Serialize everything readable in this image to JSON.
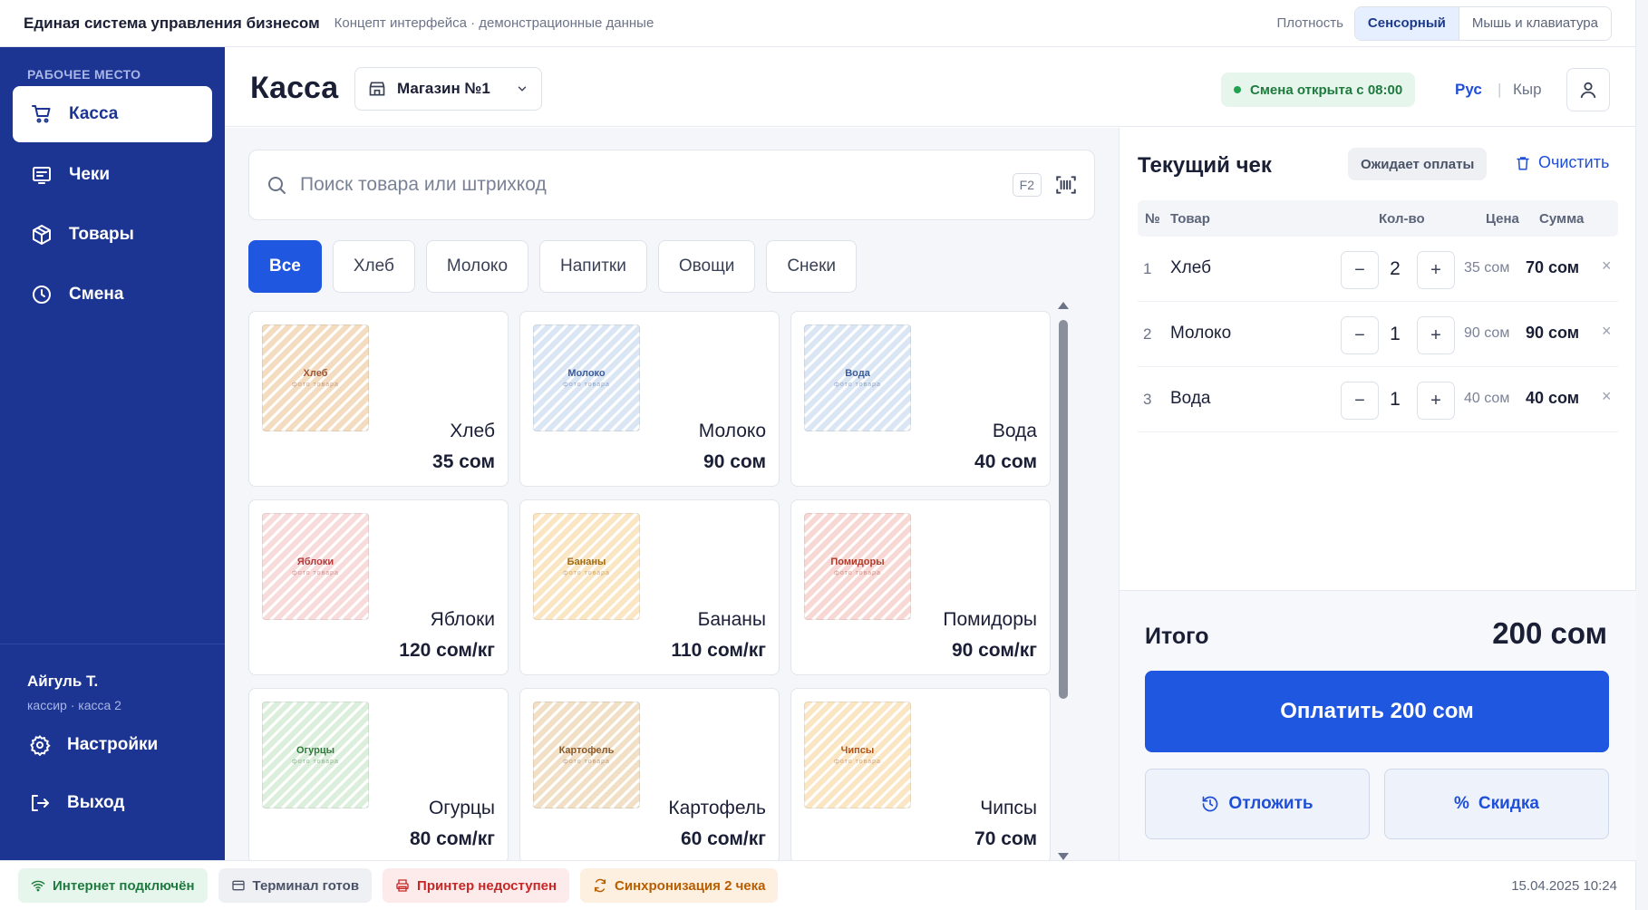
{
  "topbar": {
    "app_title": "Единая система управления бизнесом",
    "app_subtitle": "Концепт интерфейса · демонстрационные данные",
    "density_label": "Плотность",
    "density_options": [
      "Сенсорный",
      "Мышь и клавиатура"
    ],
    "density_selected": "Сенсорный"
  },
  "sidebar": {
    "section_label": "РАБОЧЕЕ МЕСТО",
    "items": [
      {
        "label": "Касса",
        "icon": "cart-icon",
        "active": true
      },
      {
        "label": "Чеки",
        "icon": "receipt-icon",
        "active": false
      },
      {
        "label": "Товары",
        "icon": "box-icon",
        "active": false
      },
      {
        "label": "Смена",
        "icon": "clock-icon",
        "active": false
      }
    ],
    "user": {
      "name": "Айгуль Т.",
      "role": "кассир · касса 2"
    },
    "settings_label": "Настройки",
    "logout_label": "Выход"
  },
  "header": {
    "title": "Касса",
    "store": "Магазин №1",
    "shift_status": "Смена открыта с 08:00",
    "languages": [
      "Рус",
      "Кыр"
    ],
    "language_active": "Рус"
  },
  "search": {
    "placeholder": "Поиск товара или штрихкод",
    "hotkey": "F2"
  },
  "categories": [
    "Все",
    "Хлеб",
    "Молоко",
    "Напитки",
    "Овощи",
    "Снеки"
  ],
  "category_active": "Все",
  "products": [
    {
      "name": "Хлеб",
      "price": "35 сом",
      "thumb_label": "Хлеб",
      "thumb_sub": "фото товара",
      "tint": "#f3dcbf",
      "ink": "#a0522d"
    },
    {
      "name": "Молоко",
      "price": "90 сом",
      "thumb_label": "Молоко",
      "thumb_sub": "фото товара",
      "tint": "#dbe6f5",
      "ink": "#3b5b99"
    },
    {
      "name": "Вода",
      "price": "40 сом",
      "thumb_label": "Вода",
      "thumb_sub": "фото товара",
      "tint": "#dbe6f5",
      "ink": "#3b5b99"
    },
    {
      "name": "Яблоки",
      "price": "120 сом/кг",
      "thumb_label": "Яблоки",
      "thumb_sub": "фото товара",
      "tint": "#f8dcdc",
      "ink": "#b23a3a"
    },
    {
      "name": "Бананы",
      "price": "110 сом/кг",
      "thumb_label": "Бананы",
      "thumb_sub": "фото товара",
      "tint": "#fbe6c4",
      "ink": "#a06a10"
    },
    {
      "name": "Помидоры",
      "price": "90 сом/кг",
      "thumb_label": "Помидоры",
      "thumb_sub": "фото товара",
      "tint": "#f8d8d4",
      "ink": "#b23a2a"
    },
    {
      "name": "Огурцы",
      "price": "80 сом/кг",
      "thumb_label": "Огурцы",
      "thumb_sub": "фото товара",
      "tint": "#dcefdc",
      "ink": "#2f7a3a"
    },
    {
      "name": "Картофель",
      "price": "60 сом/кг",
      "thumb_label": "Картофель",
      "thumb_sub": "фото товара",
      "tint": "#f1dfc6",
      "ink": "#8a5a2a"
    },
    {
      "name": "Чипсы",
      "price": "70 сом",
      "thumb_label": "Чипсы",
      "thumb_sub": "фото товара",
      "tint": "#fbe6c4",
      "ink": "#b0561a"
    }
  ],
  "receipt": {
    "title": "Текущий чек",
    "status": "Ожидает оплаты",
    "clear_label": "Очистить",
    "columns": {
      "num": "№",
      "item": "Товар",
      "qty": "Кол-во",
      "price": "Цена",
      "sum": "Сумма"
    },
    "lines": [
      {
        "num": "1",
        "name": "Хлеб",
        "qty": "2",
        "price": "35 сом",
        "sum": "70 сом"
      },
      {
        "num": "2",
        "name": "Молоко",
        "qty": "1",
        "price": "90 сом",
        "sum": "90 сом"
      },
      {
        "num": "3",
        "name": "Вода",
        "qty": "1",
        "price": "40 сом",
        "sum": "40 сом"
      }
    ],
    "minus": "−",
    "plus": "+",
    "remove": "×",
    "total_label": "Итого",
    "total_value": "200 сом",
    "pay_label": "Оплатить 200 сом",
    "postpone_label": "Отложить",
    "discount_label": "Скидка"
  },
  "statusbar": {
    "internet": "Интернет подключён",
    "terminal": "Терминал готов",
    "printer": "Принтер недоступен",
    "sync": "Синхронизация 2 чека",
    "datetime": "15.04.2025 10:24"
  },
  "colors": {
    "sidebar": "#1d3592",
    "accent": "#1f57e0",
    "ok": "#1e7a3e",
    "error": "#c62828",
    "warning": "#b85d00"
  }
}
